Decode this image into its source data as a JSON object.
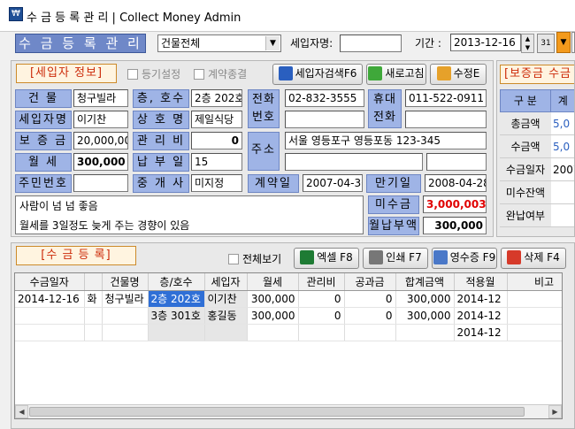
{
  "window": {
    "title": "수 금 등 록 관 리  |  Collect Money Admin"
  },
  "toolbar": {
    "banner": "수 금 등 록 관 리",
    "building_select": "건물전체",
    "tenant_name_label": "세입자명:",
    "tenant_name_value": "",
    "period_label": "기간 :",
    "date_from": "2013-12-16"
  },
  "tenant_section": {
    "title": "[세입자 정보]",
    "chk_register": "등기설정",
    "chk_contract_end": "계약종결",
    "btn_search": "세입자검색F6",
    "btn_refresh": "새로고침",
    "btn_edit": "수정E"
  },
  "fields": {
    "building_label": "건    물",
    "building_value": "청구빌라",
    "floor_label": "층, 호수",
    "floor_value": "2층 202호",
    "tenant_label": "세입자명",
    "tenant_value": "이기찬",
    "shop_label": "상 호 명",
    "shop_value": "제일식당",
    "deposit_label": "보 증 금",
    "deposit_value": "20,000,000",
    "mgmt_label": "관 리 비",
    "mgmt_value": "0",
    "rent_label": "월    세",
    "rent_value": "300,000",
    "payday_label": "납 부 일",
    "payday_value": "15",
    "resid_label": "주민번호",
    "resid_value": "",
    "broker_label": "중 개 사",
    "broker_value": "미지정",
    "phone_label": "전화번호",
    "phone_value": "02-832-3555",
    "phone_value2": "",
    "mobile_label": "휴대전화",
    "mobile_value": "011-522-0911",
    "mobile_value2": "",
    "addr_label": "주소",
    "addr_value": "서울 영등포구 영등포동 123-345",
    "addr_value2": "",
    "addr_value3": "",
    "contract_label": "계약일",
    "contract_value": "2007-04-30",
    "expire_label": "만기일",
    "expire_value": "2008-04-28",
    "unpaid_label": "미수금",
    "unpaid_value": "3,000,003",
    "monthly_label": "월납부액",
    "monthly_value": "300,000"
  },
  "memo": {
    "line1": "사람이 넘 넘 좋음",
    "line2": "월세를 3일정도 늦게 주는 경향이 있음"
  },
  "deposit_section": {
    "title": "[보증금 수금",
    "col_header": "구 분",
    "col_header2": "계",
    "rows": [
      {
        "label": "총금액",
        "value": "5,0"
      },
      {
        "label": "수금액",
        "value": "5,0"
      },
      {
        "label": "수금일자",
        "value": "2007"
      },
      {
        "label": "미수잔액",
        "value": ""
      },
      {
        "label": "완납여부",
        "value": ""
      }
    ]
  },
  "collect_section": {
    "title": "[수 금 등 록]",
    "chk_all": "전체보기",
    "btn_excel": "엑셀 F8",
    "btn_print": "인쇄 F7",
    "btn_receipt": "영수증 F9",
    "btn_delete": "삭제 F4"
  },
  "grid": {
    "headers": [
      "수금일자",
      "",
      "건물명",
      "층/호수",
      "세입자",
      "월세",
      "관리비",
      "공과금",
      "합계금액",
      "적용월",
      "비고"
    ],
    "rows": [
      [
        "2014-12-16",
        "화",
        "청구빌라",
        "2층 202호",
        "이기찬",
        "300,000",
        "0",
        "0",
        "300,000",
        "2014-12",
        ""
      ],
      [
        "",
        "",
        "",
        "3층 301호",
        "홍길동",
        "300,000",
        "0",
        "0",
        "300,000",
        "2014-12",
        ""
      ],
      [
        "",
        "",
        "",
        "",
        "",
        "",
        "",
        "",
        "",
        "2014-12",
        ""
      ]
    ]
  }
}
